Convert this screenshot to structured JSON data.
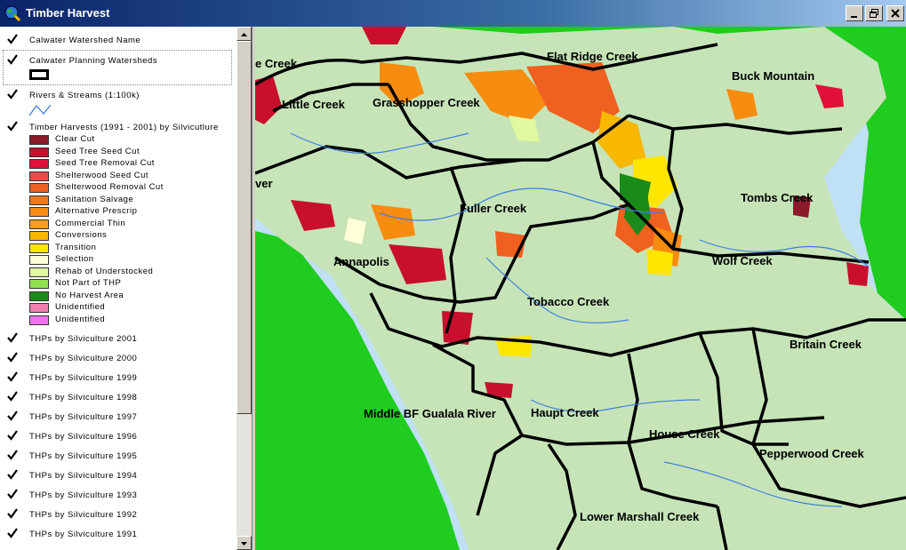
{
  "window": {
    "title": "Timber Harvest"
  },
  "colors": {
    "titlebar": "#0a246a",
    "ocean": "#bfe0f5",
    "land": "#1fcc1f",
    "basemap": "#c6e4b8",
    "watershed_border": "#000000"
  },
  "legend": {
    "layers": [
      {
        "label": "Calwater Watershed Name",
        "checked": true
      },
      {
        "label": "Calwater Planning Watersheds",
        "checked": true
      },
      {
        "label": "Rivers & Streams (1:100k)",
        "checked": true
      },
      {
        "label": "Timber Harvests (1991 - 2001) by Silvicutlure",
        "checked": true
      }
    ],
    "silviculture_classes": [
      {
        "label": "Clear Cut",
        "color": "#8b1a2b"
      },
      {
        "label": "Seed Tree Seed Cut",
        "color": "#c8102e"
      },
      {
        "label": "Seed Tree Removal Cut",
        "color": "#e0103a"
      },
      {
        "label": "Shelterwood Seed Cut",
        "color": "#f04848"
      },
      {
        "label": "Shelterwood Removal Cut",
        "color": "#f06020"
      },
      {
        "label": "Sanitation Salvage",
        "color": "#f07818"
      },
      {
        "label": "Alternative Prescrip",
        "color": "#f88c10"
      },
      {
        "label": "Commercial Thin",
        "color": "#fa9c18"
      },
      {
        "label": "Conversions",
        "color": "#f8b800"
      },
      {
        "label": "Transition",
        "color": "#ffe600"
      },
      {
        "label": "Selection",
        "color": "#ffffd8"
      },
      {
        "label": "Rehab of Understocked",
        "color": "#e0f8a0"
      },
      {
        "label": "Not Part of THP",
        "color": "#90e050"
      },
      {
        "label": "No Harvest Area",
        "color": "#1a8a1a"
      },
      {
        "label": "Unidentified",
        "color": "#f080b0"
      },
      {
        "label": "Unidentified",
        "color": "#f070f0"
      }
    ],
    "year_layers": [
      {
        "label": "THPs by Silviculture 2001",
        "checked": true
      },
      {
        "label": "THPs by Silviculture 2000",
        "checked": true
      },
      {
        "label": "THPs by Silviculture 1999",
        "checked": true
      },
      {
        "label": "THPs by Silviculture 1998",
        "checked": true
      },
      {
        "label": "THPs by Silviculture 1997",
        "checked": true
      },
      {
        "label": "THPs by Silviculture 1996",
        "checked": true
      },
      {
        "label": "THPs by Silviculture 1995",
        "checked": true
      },
      {
        "label": "THPs by Silviculture 1994",
        "checked": true
      },
      {
        "label": "THPs by Silviculture 1993",
        "checked": true
      },
      {
        "label": "THPs by Silviculture 1992",
        "checked": true
      },
      {
        "label": "THPs by Silviculture 1991",
        "checked": true
      }
    ]
  },
  "map": {
    "watershed_labels": [
      "Flat Ridge Creek",
      "Buck Mountain",
      "Little Creek",
      "Grasshopper Creek",
      "Fuller Creek",
      "Tombs Creek",
      "Annapolis",
      "Wolf Creek",
      "Tobacco Creek",
      "Britain Creek",
      "Middle BF Gualala River",
      "Haupt Creek",
      "House Creek",
      "Pepperwood Creek",
      "Lower Marshall Creek",
      "e Creek",
      "ver"
    ]
  }
}
